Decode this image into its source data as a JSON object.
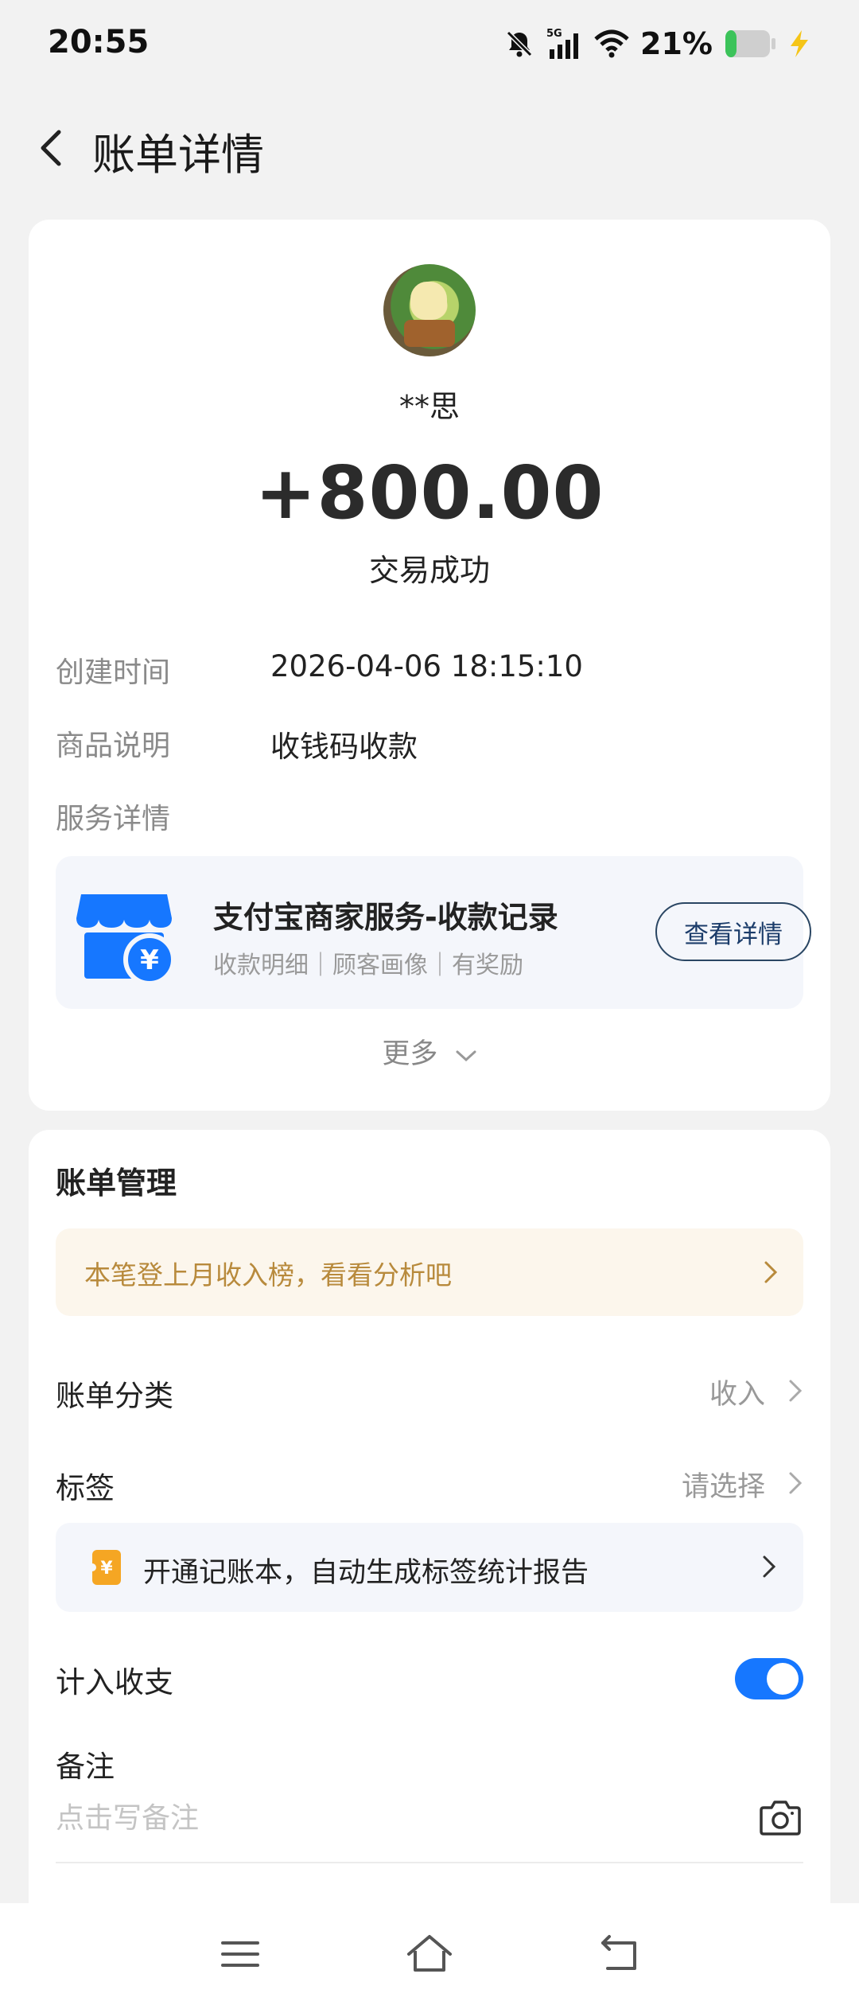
{
  "status_bar": {
    "time": "20:55",
    "network": "5G",
    "battery_percent": "21%",
    "icons": [
      "bell-muted-icon",
      "signal-5g-icon",
      "wifi-icon",
      "battery-icon",
      "charging-icon"
    ]
  },
  "header": {
    "title": "账单详情",
    "back_icon": "chevron-left-icon"
  },
  "transaction": {
    "payer_name": "**思",
    "amount": "+800.00",
    "status": "交易成功"
  },
  "details": {
    "created_label": "创建时间",
    "created_value": "2026-04-06 18:15:10",
    "item_label": "商品说明",
    "item_value": "收钱码收款",
    "service_label": "服务详情"
  },
  "service_card": {
    "icon": "merchant-shop-icon",
    "title": "支付宝商家服务-收款记录",
    "subtitle": "收款明细｜顾客画像｜有奖励",
    "button_label": "查看详情"
  },
  "more_label": "更多",
  "management": {
    "title": "账单管理",
    "promo_text": "本笔登上月收入榜，看看分析吧",
    "category_label": "账单分类",
    "category_value": "收入",
    "tag_label": "标签",
    "tag_value": "请选择",
    "notebook_text": "开通记账本，自动生成标签统计报告",
    "include_label": "计入收支",
    "include_enabled": true,
    "remark_label": "备注",
    "remark_placeholder": "点击写备注"
  },
  "colors": {
    "accent_blue": "#1677ff",
    "promo_text": "#b88a3c",
    "button_border": "#2a4663"
  }
}
